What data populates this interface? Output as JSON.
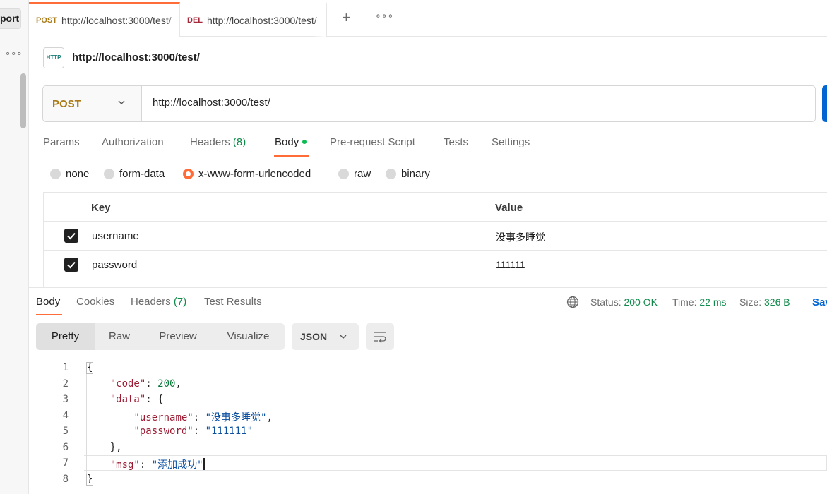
{
  "sidebar": {
    "button_label": "port",
    "more": "∘∘∘"
  },
  "tabs": [
    {
      "method": "POST",
      "url": "http://localhost:3000/test/",
      "active": true
    },
    {
      "method": "DEL",
      "url": "http://localhost:3000/test/",
      "active": false
    }
  ],
  "tabbar": {
    "add": "+",
    "more": "∘∘∘"
  },
  "request": {
    "icon_text": "HTTP",
    "title": "http://localhost:3000/test/",
    "method": "POST",
    "url": "http://localhost:3000/test/"
  },
  "request_tabs": {
    "params": "Params",
    "authorization": "Authorization",
    "headers": "Headers",
    "headers_count": "(8)",
    "body": "Body",
    "prerequest": "Pre-request Script",
    "tests": "Tests",
    "settings": "Settings"
  },
  "body_types": {
    "none": "none",
    "form_data": "form-data",
    "urlencoded": "x-www-form-urlencoded",
    "raw": "raw",
    "binary": "binary",
    "selected": "x-www-form-urlencoded"
  },
  "kv_table": {
    "key_header": "Key",
    "value_header": "Value",
    "rows": [
      {
        "checked": true,
        "key": "username",
        "value": "没事多睡觉"
      },
      {
        "checked": true,
        "key": "password",
        "value": "111111"
      }
    ]
  },
  "response_tabs": {
    "body": "Body",
    "cookies": "Cookies",
    "headers": "Headers",
    "headers_count": "(7)",
    "test_results": "Test Results"
  },
  "status": {
    "status_label": "Status:",
    "status_value": "200 OK",
    "time_label": "Time:",
    "time_value": "22 ms",
    "size_label": "Size:",
    "size_value": "326 B",
    "save": "Sav"
  },
  "view_modes": {
    "pretty": "Pretty",
    "raw": "Raw",
    "preview": "Preview",
    "visualize": "Visualize",
    "selected": "Pretty"
  },
  "format": "JSON",
  "response_code": {
    "line_numbers": [
      "1",
      "2",
      "3",
      "4",
      "5",
      "6",
      "7",
      "8"
    ],
    "open_brace": "{",
    "code_key": "\"code\"",
    "code_value": "200",
    "data_key": "\"data\"",
    "username_key": "\"username\"",
    "username_value": "\"没事多睡觉\"",
    "password_key": "\"password\"",
    "password_value": "\"111111\"",
    "msg_key": "\"msg\"",
    "msg_value": "\"添加成功\"",
    "close_brace": "}"
  },
  "colors": {
    "accent": "#ff6c37",
    "post_method": "#a97a16",
    "delete_method": "#a5283b",
    "success": "#0f8a4a",
    "send_blue": "#0265d2"
  }
}
